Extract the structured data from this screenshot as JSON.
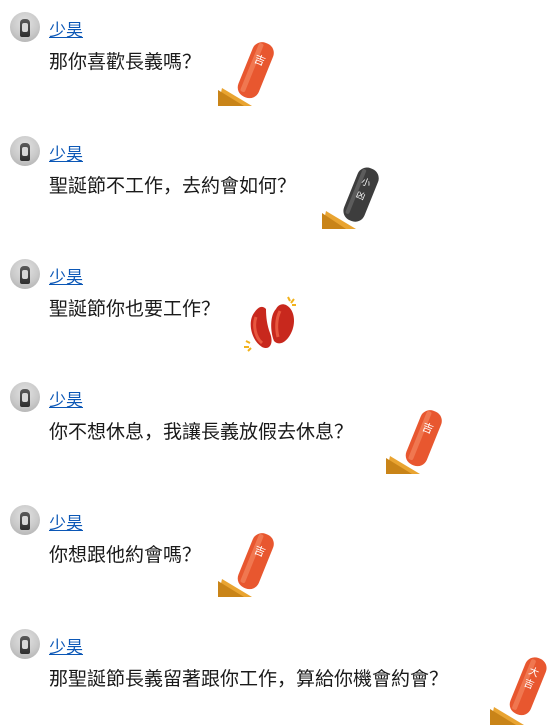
{
  "messages": [
    {
      "sender": "少昊",
      "text": "那你喜歡長義嗎？",
      "sticker": "lucky-stick-icon",
      "sticker_char": "吉"
    },
    {
      "sender": "少昊",
      "text": "聖誕節不工作，去約會如何？",
      "sticker": "bad-luck-stick-icon",
      "sticker_char": "小凶"
    },
    {
      "sender": "少昊",
      "text": "聖誕節你也要工作？",
      "sticker": "moon-blocks-icon",
      "sticker_char": ""
    },
    {
      "sender": "少昊",
      "text": "你不想休息，我讓長義放假去休息？",
      "sticker": "lucky-stick-icon",
      "sticker_char": "吉"
    },
    {
      "sender": "少昊",
      "text": "你想跟他約會嗎？",
      "sticker": "lucky-stick-icon",
      "sticker_char": "吉"
    },
    {
      "sender": "少昊",
      "text": "那聖誕節長義留著跟你工作，算給你機會約會？",
      "sticker": "great-luck-stick-icon",
      "sticker_char": "大吉"
    }
  ],
  "colors": {
    "link": "#0b57b6",
    "stick_red": "#e8572f",
    "stick_dark": "#3d3d3d",
    "cup": "#e9a431"
  }
}
